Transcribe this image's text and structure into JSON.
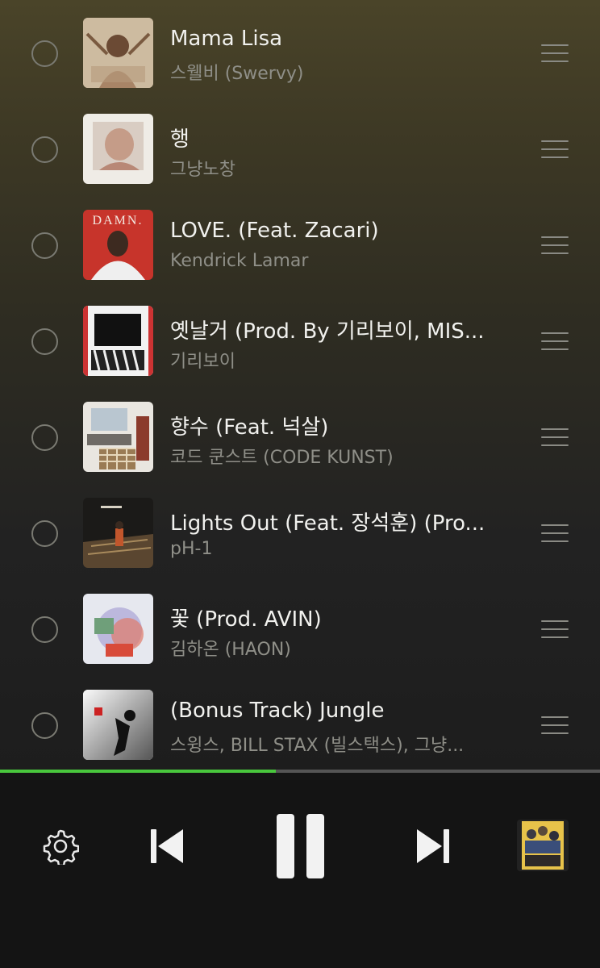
{
  "tracks": [
    {
      "title": "Mama Lisa",
      "artist": "스웰비 (Swervy)"
    },
    {
      "title": "행",
      "artist": "그냥노창"
    },
    {
      "title": "LOVE. (Feat. Zacari)",
      "artist": "Kendrick Lamar"
    },
    {
      "title": "옛날거 (Prod. By 기리보이, MIS...",
      "artist": "기리보이"
    },
    {
      "title": "향수 (Feat. 넉살)",
      "artist": "코드 쿤스트 (CODE KUNST)"
    },
    {
      "title": "Lights Out (Feat. 장석훈) (Pro...",
      "artist": "pH-1"
    },
    {
      "title": "꽃 (Prod. AVIN)",
      "artist": "김하온 (HAON)"
    },
    {
      "title": "(Bonus Track) Jungle",
      "artist": "스윙스, BILL STAX (빌스택스), 그냥..."
    }
  ],
  "album_art_text": {
    "damn": "DAMN."
  },
  "progress": {
    "fraction": 0.46
  },
  "player": {
    "icons": [
      "gear-icon",
      "previous-icon",
      "pause-icon",
      "next-icon"
    ],
    "accent": "#49c73d"
  }
}
